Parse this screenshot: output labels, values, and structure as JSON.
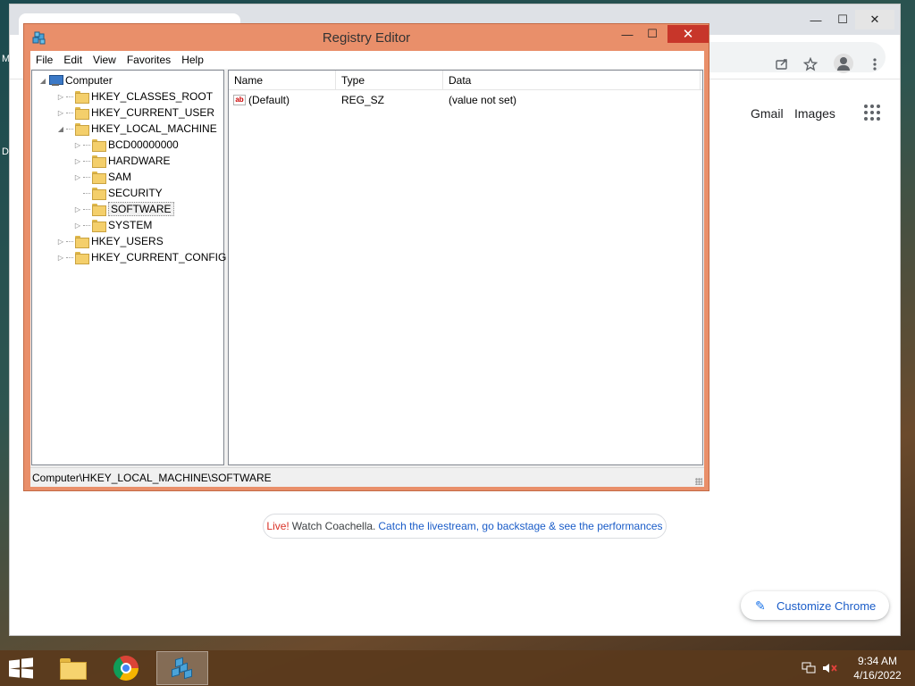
{
  "desktop": {
    "edge_glyphs": [
      "M",
      "D"
    ]
  },
  "chrome": {
    "window_controls": {
      "minimize": "—",
      "maximize": "☐",
      "close": "✕"
    },
    "toolbar_icons": [
      "share-icon",
      "star-icon",
      "profile-icon",
      "more-icon"
    ],
    "links": {
      "gmail": "Gmail",
      "images": "Images"
    },
    "promo": {
      "live": "Live!",
      "watch": "Watch Coachella.",
      "link": "Catch the livestream, go backstage & see the performances"
    },
    "customize_label": "Customize Chrome"
  },
  "regedit": {
    "title": "Registry Editor",
    "window_controls": {
      "minimize": "—",
      "maximize": "☐",
      "close": "✕"
    },
    "menu": [
      "File",
      "Edit",
      "View",
      "Favorites",
      "Help"
    ],
    "tree": {
      "root": "Computer",
      "hives": [
        {
          "label": "HKEY_CLASSES_ROOT",
          "expander": "▷"
        },
        {
          "label": "HKEY_CURRENT_USER",
          "expander": "▷"
        },
        {
          "label": "HKEY_LOCAL_MACHINE",
          "expander": "◢"
        }
      ],
      "hklm_children": [
        {
          "label": "BCD00000000",
          "expander": "▷"
        },
        {
          "label": "HARDWARE",
          "expander": "▷"
        },
        {
          "label": "SAM",
          "expander": "▷"
        },
        {
          "label": "SECURITY",
          "expander": ""
        },
        {
          "label": "SOFTWARE",
          "expander": "▷",
          "selected": true
        },
        {
          "label": "SYSTEM",
          "expander": "▷"
        }
      ],
      "more_hives": [
        {
          "label": "HKEY_USERS",
          "expander": "▷"
        },
        {
          "label": "HKEY_CURRENT_CONFIG",
          "expander": "▷"
        }
      ]
    },
    "list": {
      "columns": [
        "Name",
        "Type",
        "Data"
      ],
      "rows": [
        {
          "icon": "ab",
          "name": "(Default)",
          "type": "REG_SZ",
          "data": "(value not set)"
        }
      ]
    },
    "status_path": "Computer\\HKEY_LOCAL_MACHINE\\SOFTWARE"
  },
  "taskbar": {
    "apps": [
      "file-explorer",
      "google-chrome",
      "registry-editor"
    ],
    "active_app": "registry-editor",
    "tray_icons": [
      "network-icon",
      "volume-muted-icon"
    ],
    "time": "9:34 AM",
    "date": "4/16/2022"
  }
}
